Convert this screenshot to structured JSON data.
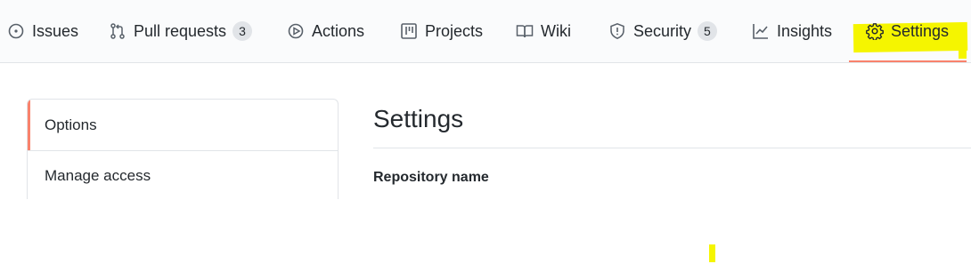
{
  "nav": {
    "tabs": [
      {
        "label": "Issues",
        "icon": "issue-opened-icon"
      },
      {
        "label": "Pull requests",
        "icon": "git-pull-request-icon",
        "count": "3"
      },
      {
        "label": "Actions",
        "icon": "play-icon"
      },
      {
        "label": "Projects",
        "icon": "project-icon"
      },
      {
        "label": "Wiki",
        "icon": "book-icon"
      },
      {
        "label": "Security",
        "icon": "shield-icon",
        "count": "5"
      },
      {
        "label": "Insights",
        "icon": "graph-icon"
      },
      {
        "label": "Settings",
        "icon": "gear-icon",
        "selected": true
      }
    ],
    "selected_underline_color": "#f9826c",
    "highlight_color": "#f5f500"
  },
  "sidebar": {
    "items": [
      {
        "label": "Options",
        "selected": true
      },
      {
        "label": "Manage access"
      }
    ]
  },
  "main": {
    "title": "Settings",
    "field_label": "Repository name"
  }
}
